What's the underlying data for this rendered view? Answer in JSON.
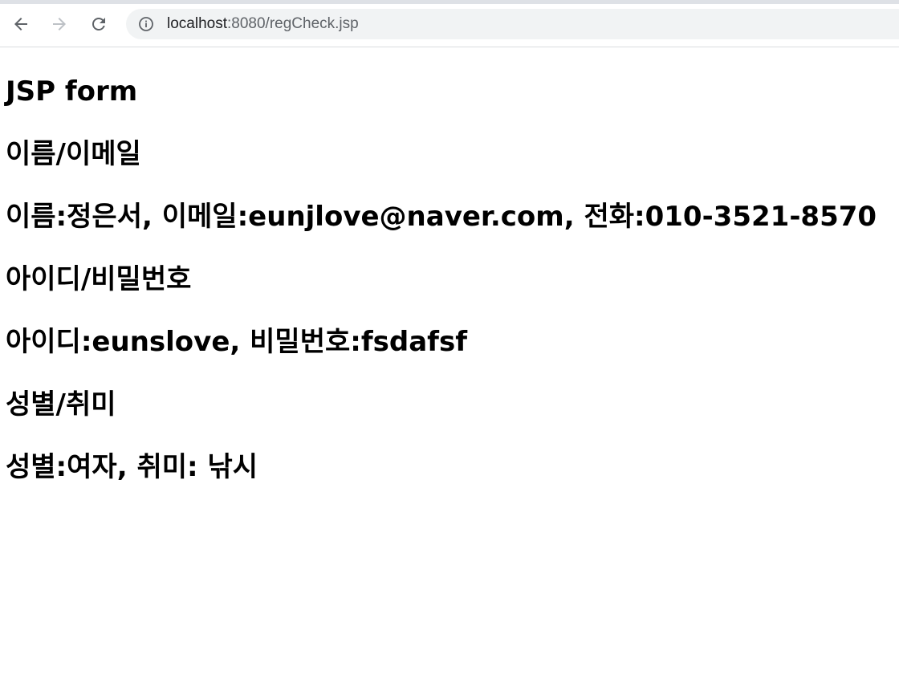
{
  "browser": {
    "url_host": "localhost",
    "url_rest": ":8080/regCheck.jsp",
    "icons": {
      "back": "back-arrow-icon",
      "forward": "forward-arrow-icon",
      "reload": "reload-icon",
      "site_info": "info-icon"
    },
    "colors": {
      "omnibox_bg": "#f1f3f4",
      "icon_active": "#5f6368",
      "icon_disabled": "#bdc1c6"
    }
  },
  "page": {
    "title": "JSP form",
    "sections": [
      {
        "heading": "이름/이메일",
        "detail": "이름:정은서, 이메일:eunjlove@naver.com, 전화:010-3521-8570"
      },
      {
        "heading": "아이디/비밀번호",
        "detail": "아이디:eunslove, 비밀번호:fsdafsf"
      },
      {
        "heading": "성별/취미",
        "detail": "성별:여자, 취미: 낚시"
      }
    ]
  }
}
